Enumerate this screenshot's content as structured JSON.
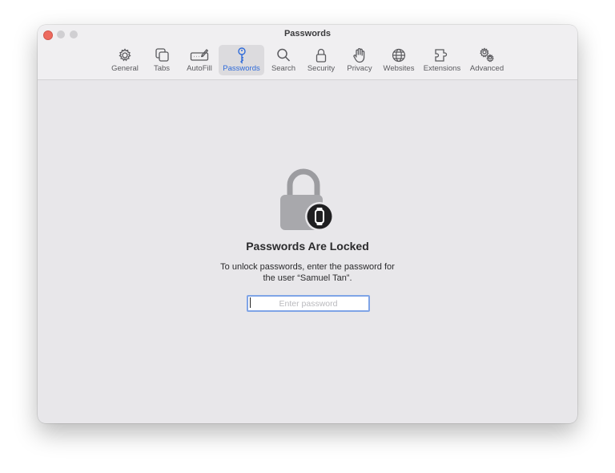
{
  "window": {
    "title": "Passwords"
  },
  "toolbar": {
    "tabs": [
      {
        "label": "General",
        "icon": "gear-icon"
      },
      {
        "label": "Tabs",
        "icon": "tabs-icon"
      },
      {
        "label": "AutoFill",
        "icon": "autofill-icon"
      },
      {
        "label": "Passwords",
        "icon": "key-icon",
        "active": true
      },
      {
        "label": "Search",
        "icon": "magnifier-icon"
      },
      {
        "label": "Security",
        "icon": "lock-icon"
      },
      {
        "label": "Privacy",
        "icon": "hand-icon"
      },
      {
        "label": "Websites",
        "icon": "globe-icon"
      },
      {
        "label": "Extensions",
        "icon": "puzzle-icon"
      },
      {
        "label": "Advanced",
        "icon": "gears-icon"
      }
    ]
  },
  "locked": {
    "icon": "padlock-with-watch-icon",
    "heading": "Passwords Are Locked",
    "message_line1": "To unlock passwords, enter the password for",
    "message_line2": "the user “Samuel Tan”.",
    "password_placeholder": "Enter password",
    "password_value": ""
  },
  "colors": {
    "accent": "#2f6bd9",
    "close_button": "#ed6a5e",
    "window_background": "#e8e7ea",
    "focus_ring": "#7fa4e6"
  }
}
